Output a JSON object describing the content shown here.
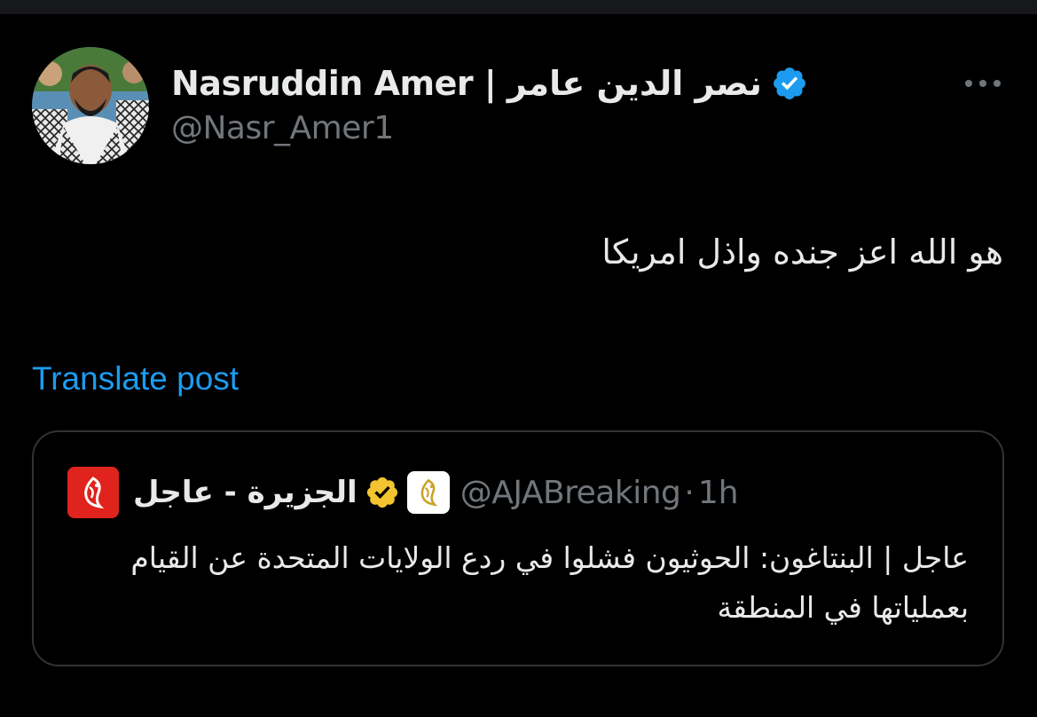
{
  "post": {
    "author": {
      "display_name": "Nasruddin Amer | نصر الدين عامر",
      "handle": "@Nasr_Amer1",
      "verified": true,
      "verified_color": "#1d9bf0"
    },
    "text": "هو الله اعز جنده واذل امريكا",
    "translate_label": "Translate post",
    "more_icon": "more-horizontal-icon",
    "quoted": {
      "display_name": "الجزيرة - عاجل",
      "handle": "@AJABreaking",
      "separator": "·",
      "time": "1h",
      "verified": true,
      "verified_color": "#f4c430",
      "logo_color": "#e0231c",
      "text": "عاجل | البنتاغون: الحوثيون فشلوا في ردع الولايات المتحدة عن القيام بعملياتها في المنطقة"
    }
  },
  "colors": {
    "background": "#000000",
    "text_primary": "#e7e9ea",
    "text_secondary": "#71767b",
    "link": "#1d9bf0",
    "border": "#2f3336"
  }
}
